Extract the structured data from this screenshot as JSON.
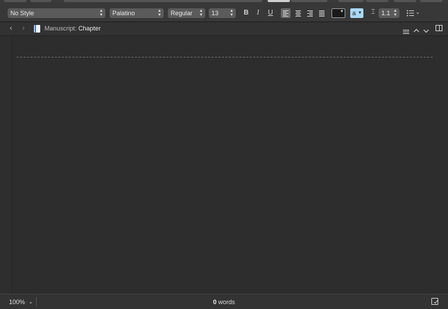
{
  "format_bar": {
    "style_select": {
      "value": "No Style",
      "icon": "chevron-updown-icon"
    },
    "font_select": {
      "value": "Palatino",
      "icon": "chevron-updown-icon"
    },
    "weight_select": {
      "value": "Regular",
      "icon": "chevron-updown-icon"
    },
    "size_select": {
      "value": "13",
      "icon": "chevron-updown-icon"
    },
    "bold_label": "B",
    "italic_label": "I",
    "underline_label": "U",
    "alignment": [
      "left",
      "center",
      "right",
      "justify"
    ],
    "alignment_selected": "left",
    "text_color": "#1a1a1a",
    "highlight_label": "a",
    "highlight_color": "#a8d8f5",
    "line_spacing": {
      "value": "1.1",
      "icon": "line-spacing-icon"
    },
    "list_icon": "list-bullets-icon"
  },
  "header_bar": {
    "breadcrumb_prefix": "Manuscript:",
    "breadcrumb_doc": "Chapter",
    "back_icon": "chevron-left-icon",
    "forward_icon": "chevron-right-icon",
    "doc_icon": "document-icon",
    "menu_icon": "menu-lines-icon",
    "up_icon": "chevron-up-icon",
    "down_icon": "chevron-down-icon",
    "split_icon": "split-view-icon"
  },
  "footer": {
    "zoom": "100%",
    "word_count": "0",
    "word_label": "words",
    "target_icon": "target-icon"
  }
}
